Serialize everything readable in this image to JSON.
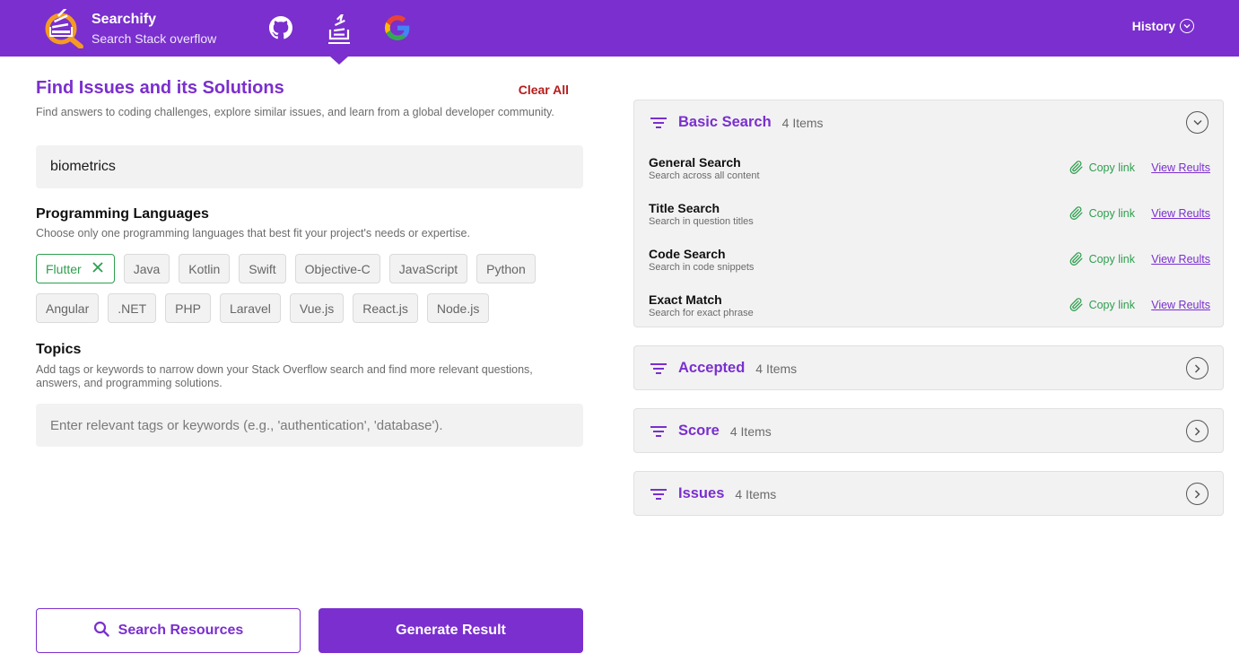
{
  "header": {
    "brand_name": "Searchify",
    "brand_subtitle": "Search Stack overflow",
    "nav": [
      "github-icon",
      "stackoverflow-icon",
      "google-icon"
    ],
    "active_nav": "stackoverflow-icon",
    "history_label": "History",
    "background": "#7a2fce"
  },
  "main": {
    "title": "Find Issues and its Solutions",
    "clear_all_label": "Clear All",
    "description": "Find answers to coding challenges, explore similar issues, and learn from a global developer community.",
    "search_value": "biometrics"
  },
  "languages": {
    "title": "Programming Languages",
    "description": "Choose only one programming languages that best fit your project's needs or expertise.",
    "selected": "Flutter",
    "items": [
      "Flutter",
      "Java",
      "Kotlin",
      "Swift",
      "Objective-C",
      "JavaScript",
      "Python",
      "Angular",
      ".NET",
      "PHP",
      "Laravel",
      "Vue.js",
      "React.js",
      "Node.js"
    ]
  },
  "topics": {
    "title": "Topics",
    "description": "Add tags or keywords to narrow down your Stack Overflow search and find more relevant questions, answers, and programming solutions.",
    "placeholder": "Enter relevant tags or keywords (e.g., 'authentication', 'database')."
  },
  "actions": {
    "search_resources_label": "Search Resources",
    "generate_result_label": "Generate Result"
  },
  "panels": [
    {
      "title": "Basic Search",
      "count": "4 Items",
      "expanded": true,
      "rows": [
        {
          "title": "General Search",
          "subtitle": "Search across all content",
          "copy": "Copy link",
          "view": "View Reults"
        },
        {
          "title": "Title Search",
          "subtitle": "Search in question titles",
          "copy": "Copy link",
          "view": "View Reults"
        },
        {
          "title": "Code Search",
          "subtitle": "Search in code snippets",
          "copy": "Copy link",
          "view": "View Reults"
        },
        {
          "title": "Exact Match",
          "subtitle": "Search for exact phrase",
          "copy": "Copy link",
          "view": "View Reults"
        }
      ]
    },
    {
      "title": "Accepted",
      "count": "4 Items",
      "expanded": false
    },
    {
      "title": "Score",
      "count": "4 Items",
      "expanded": false
    },
    {
      "title": "Issues",
      "count": "4 Items",
      "expanded": false
    }
  ],
  "colors": {
    "accent": "#7a2fce",
    "success": "#2e9e4f",
    "danger": "#b71c1c"
  }
}
